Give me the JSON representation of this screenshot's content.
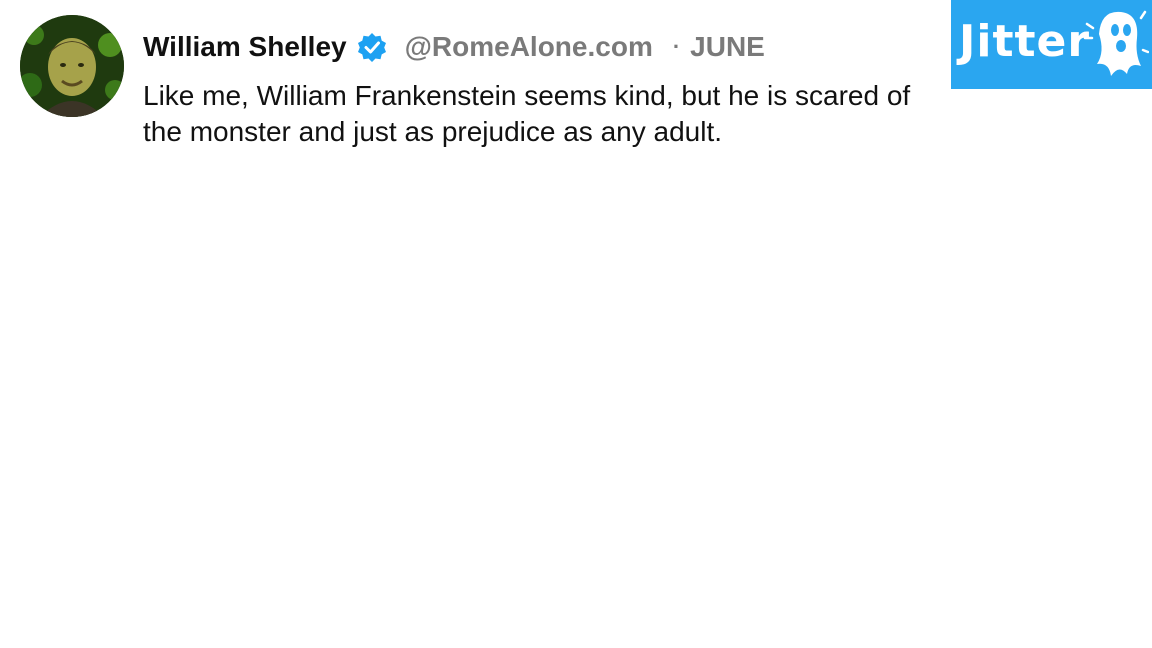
{
  "tweet": {
    "author_name": "William Shelley",
    "verified_icon": "verified-badge-icon",
    "handle": "@RomeAlone.com",
    "separator": "·",
    "date": "JUNE",
    "text": "Like me, William Frankenstein seems kind, but he is scared of the monster and just as prejudice as any adult."
  },
  "brand": {
    "logo_text": "Jitter",
    "logo_icon": "ghost-icon",
    "color": "#2aa6f0"
  },
  "colors": {
    "name": "#111111",
    "meta": "#7a7a7a",
    "verified": "#1da1f2"
  }
}
